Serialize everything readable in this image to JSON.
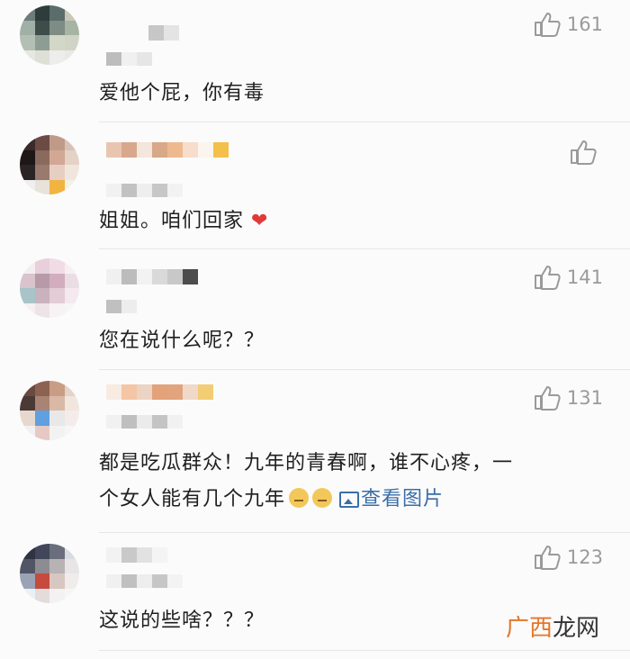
{
  "comments": [
    {
      "likes": "161",
      "text": "爱他个屁，你有毒"
    },
    {
      "likes": "",
      "text": "姐姐。咱们回家",
      "emoji": "❤"
    },
    {
      "likes": "141",
      "text": "您在说什么呢？？"
    },
    {
      "likes": "131",
      "line1": "都是吃瓜群众！九年的青春啊，谁不心疼，一",
      "line2": "个女人能有几个九年",
      "link": "查看图片"
    },
    {
      "likes": "123",
      "text": "这说的些啥？？？"
    }
  ],
  "watermark": {
    "part1": "广西",
    "part2": "龙网"
  },
  "icons": {
    "like": "thumbs-up-icon",
    "image_link": "image-icon"
  }
}
